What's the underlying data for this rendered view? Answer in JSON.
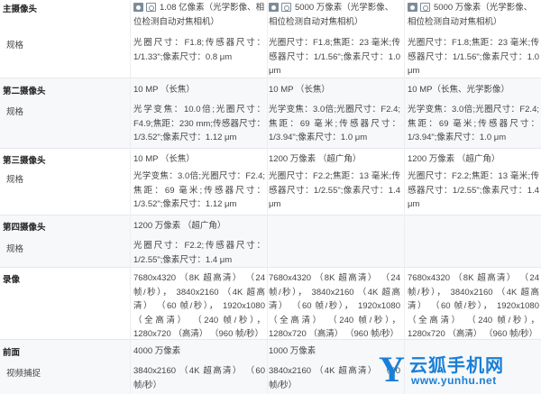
{
  "main_camera": {
    "label": "主摄像头",
    "c1": "1.08 亿像素（光学影像、相位检测自动对焦相机）",
    "c2": "5000 万像素（光学影像、相位检测自动对焦相机）",
    "c3": "5000 万像素（光学影像、相位检测自动对焦相机）"
  },
  "main_spec": {
    "label": "规格",
    "c1": "光圈尺寸：F1.8;传感器尺寸：1/1.33\";像素尺寸：0.8 μm",
    "c2": "光圈尺寸：F1.8;焦距：23 毫米;传感器尺寸：1/1.56\";像素尺寸：1.0 μm",
    "c3": "光圈尺寸：F1.8;焦距：23 毫米;传感器尺寸：1/1.56\";像素尺寸：1.0 μm"
  },
  "second_camera": {
    "label": "第二摄像头",
    "c1": "10 MP （长焦）",
    "c2": "10 MP （长焦）",
    "c3": "10 MP（长焦、光学影像）"
  },
  "second_spec": {
    "label": "规格",
    "c1": "光学变焦：10.0倍;光圈尺寸：F4.9;焦距：230 mm;传感器尺寸：1/3.52\";像素尺寸：1.12 μm",
    "c2": "光学变焦：3.0倍;光圈尺寸：F2.4;焦距：69 毫米;传感器尺寸：1/3.94\";像素尺寸：1.0 μm",
    "c3": "光学变焦：3.0倍;光圈尺寸：F2.4;焦距：69 毫米;传感器尺寸：1/3.94\";像素尺寸：1.0 μm"
  },
  "third_camera": {
    "label": "第三摄像头",
    "c1": "10 MP （长焦）",
    "c2": "1200 万像素 （超广角）",
    "c3": "1200 万像素 （超广角）"
  },
  "third_spec": {
    "label": "规格",
    "c1": "光学变焦：3.0倍;光圈尺寸：F2.4;焦距：69 毫米;传感器尺寸：1/3.52\";像素尺寸：1.12 μm",
    "c2": "光圈尺寸：F2.2;焦距：13 毫米;传感器尺寸：1/2.55\";像素尺寸：1.4 μm",
    "c3": "光圈尺寸：F2.2;焦距：13 毫米;传感器尺寸：1/2.55\";像素尺寸：1.4 μm"
  },
  "fourth_camera": {
    "label": "第四摄像头",
    "c1": "1200 万像素 （超广角）"
  },
  "fourth_spec": {
    "label": "规格",
    "c1": "光圈尺寸：F2.2;传感器尺寸：1/2.55\";像素尺寸：1.4 μm"
  },
  "video": {
    "label": "录像",
    "c1": "7680x4320 （8K 超高清） （24 帧/秒）， 3840x2160 （4K 超高清） （60 帧/秒）， 1920x1080 （全高清） （240 帧/秒）， 1280x720 （高清） （960 帧/秒）",
    "c2": "7680x4320 （8K 超高清） （24 帧/秒）， 3840x2160 （4K 超高清） （60 帧/秒）， 1920x1080 （全高清） （240 帧/秒）， 1280x720 （高清） （960 帧/秒）",
    "c3": "7680x4320 （8K 超高清） （24 帧/秒）， 3840x2160 （4K 超高清） （60 帧/秒）， 1920x1080 （全高清） （240 帧/秒）， 1280x720 （高清） （960 帧/秒）"
  },
  "front": {
    "label": "前面",
    "c1": "4000 万像素",
    "c2": "1000 万像素"
  },
  "front_video": {
    "label": "视频捕捉",
    "c1": "3840x2160 （4K 超高清） （60 帧/秒）",
    "c2": "3840x2160 （4K 超高清） （60 帧/秒）"
  },
  "watermark": {
    "y": "Y",
    "cn": "云狐手机网",
    "url": "www.yunhu.net"
  },
  "icons": [
    "camera-icon",
    "camera-outline-icon"
  ],
  "colors": {
    "row_gray": "#f7f8fa",
    "icon": "#7d8c99",
    "watermark": "#1a7fd6"
  }
}
